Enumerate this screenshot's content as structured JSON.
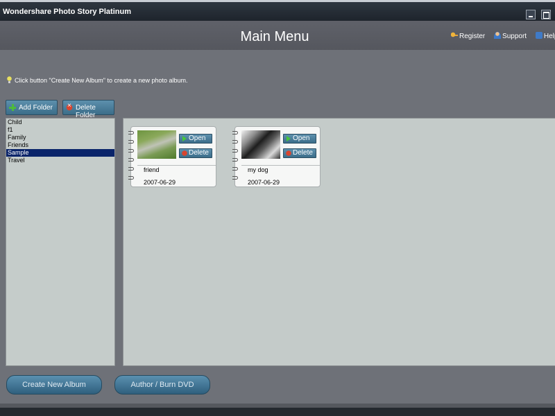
{
  "window": {
    "title": "Wondershare Photo Story Platinum"
  },
  "header": {
    "title": "Main Menu",
    "links": [
      {
        "label": "Register",
        "icon": "key-icon"
      },
      {
        "label": "Support",
        "icon": "person-icon"
      },
      {
        "label": "Help",
        "icon": "help-icon"
      }
    ]
  },
  "hint": "Click button \"Create New Album\" to create a new photo album.",
  "folder_toolbar": {
    "add_label": "Add Folder",
    "delete_label": "Delete Folder"
  },
  "folders": {
    "items": [
      "Child",
      "f1",
      "Family",
      "Friends",
      "Sample",
      "Travel"
    ],
    "selected": "Sample"
  },
  "albums": [
    {
      "name": "friend",
      "date": "2007-06-29",
      "open_label": "Open",
      "delete_label": "Delete"
    },
    {
      "name": "my dog",
      "date": "2007-06-29",
      "open_label": "Open",
      "delete_label": "Delete"
    }
  ],
  "actions": {
    "create_label": "Create New Album",
    "author_label": "Author / Burn DVD"
  },
  "colors": {
    "selection": "#0a246a",
    "button": "#3b6d89",
    "pane": "#c4cbc9"
  }
}
